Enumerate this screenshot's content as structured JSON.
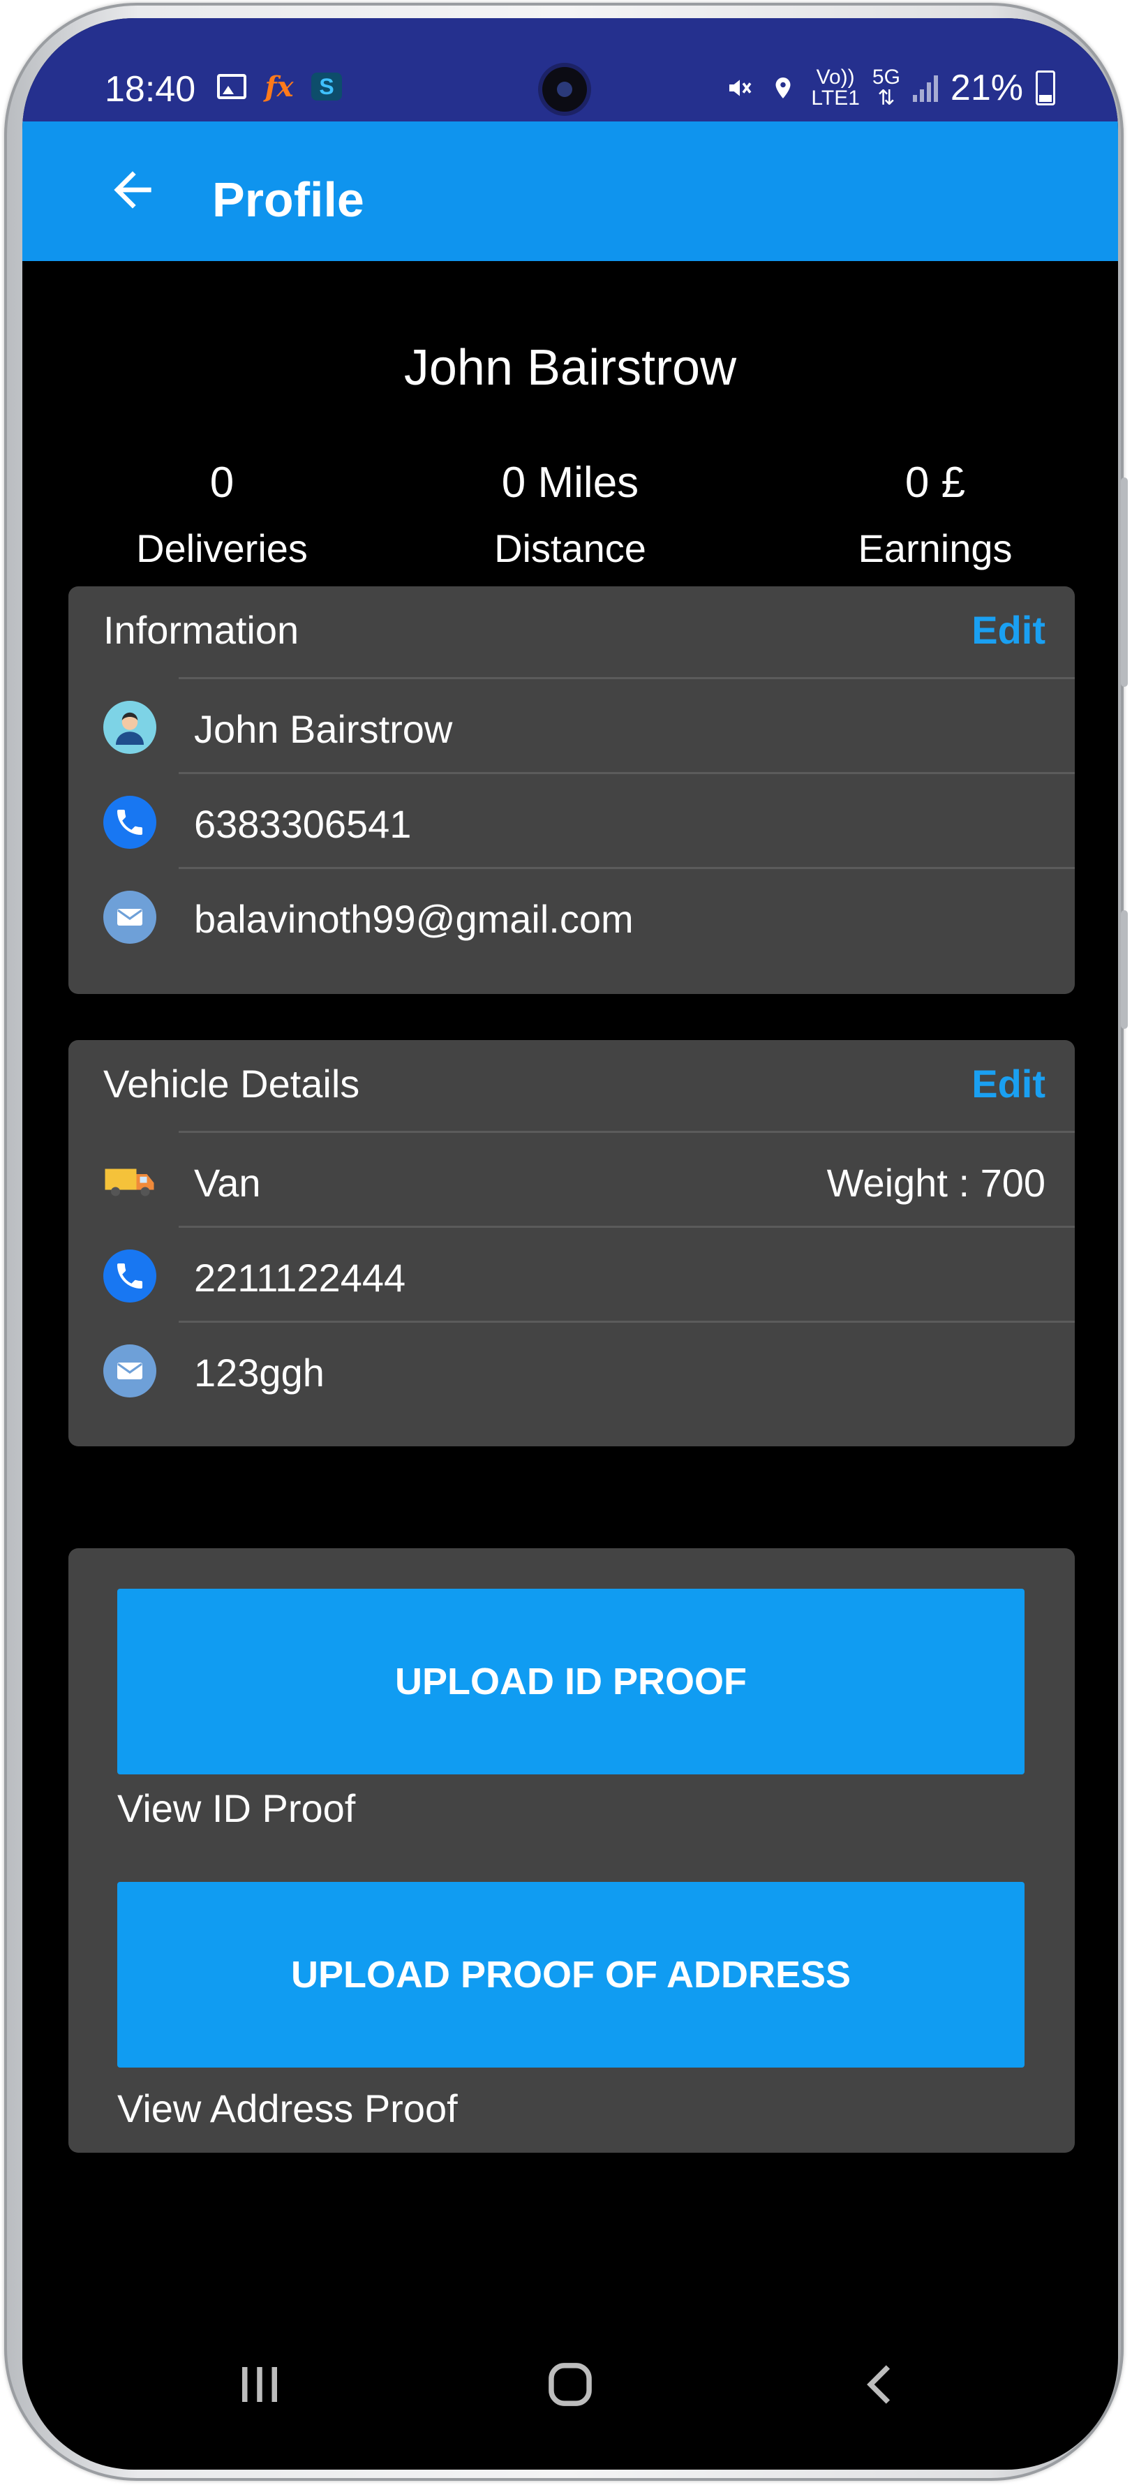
{
  "status_bar": {
    "time": "18:40",
    "network_top": "Vo))",
    "network_bottom": "LTE1",
    "gen": "5G",
    "battery": "21%"
  },
  "app_bar": {
    "title": "Profile"
  },
  "profile": {
    "name": "John Bairstrow",
    "stats": [
      {
        "value": "0",
        "label": "Deliveries"
      },
      {
        "value": "0 Miles",
        "label": "Distance"
      },
      {
        "value": "0 £",
        "label": "Earnings"
      }
    ]
  },
  "information": {
    "heading": "Information",
    "edit_label": "Edit",
    "name": "John Bairstrow",
    "phone": "6383306541",
    "email": "balavinoth99@gmail.com"
  },
  "vehicle": {
    "heading": "Vehicle Details",
    "edit_label": "Edit",
    "type": "Van",
    "weight": "Weight : 700",
    "phone": "2211122444",
    "plate": "123ggh"
  },
  "documents": {
    "upload_id_label": "UPLOAD ID PROOF",
    "view_id_label": "View ID Proof",
    "upload_address_label": "UPLOAD PROOF OF ADDRESS",
    "view_address_label": "View Address Proof"
  },
  "colors": {
    "app_bar": "#0f94ee",
    "status_bar": "#25308e",
    "accent_link": "#1aa0f2",
    "card": "#444444"
  }
}
